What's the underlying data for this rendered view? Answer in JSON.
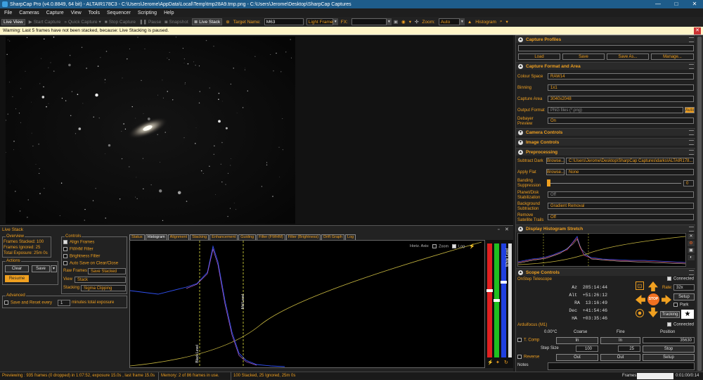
{
  "window": {
    "title": "SharpCap Pro (v4.0.8849, 64 bit) - ALTAIR178C3 - C:\\Users\\Jerome\\AppData\\Local\\Temp\\tmp28A9.tmp.png - C:\\Users\\Jerome\\Desktop\\SharpCap Captures",
    "minimize": "—",
    "maximize": "□",
    "close": "✕"
  },
  "menu": [
    "File",
    "Cameras",
    "Capture",
    "View",
    "Tools",
    "Sequencer",
    "Scripting",
    "Help"
  ],
  "toolbar": {
    "live_view": "Live View",
    "start_capture": "Start Capture",
    "quick_capture": "Quick Capture",
    "stop_capture": "Stop Capture",
    "pause": "Pause",
    "snapshot": "Snapshot",
    "live_stack": "Live Stack",
    "target_label": "Target Name:",
    "target_value": "M63",
    "frame_type": "Light Frames",
    "fx_label": "FX:",
    "zoom_label": "Zoom:",
    "zoom_value": "Auto",
    "histogram": "Histogram"
  },
  "warning": {
    "text": "Warning: Last 5 frames have not been stacked, because: Live Stacking is paused."
  },
  "capture_profiles": {
    "title": "Capture Profiles",
    "load": "Load",
    "save": "Save",
    "save_as": "Save As...",
    "manage": "Manage..."
  },
  "capture_format": {
    "title": "Capture Format and Area",
    "colour_space_label": "Colour Space",
    "colour_space": "RAW14",
    "binning_label": "Binning",
    "binning": "1x1",
    "capture_area_label": "Capture Area",
    "capture_area": "3040x2048",
    "output_format_label": "Output Format",
    "output_format": "PNG files (*.png)",
    "auto": "Auto",
    "debayer_label": "Debayer Preview",
    "debayer": "On"
  },
  "camera_controls": {
    "title": "Camera Controls"
  },
  "image_controls": {
    "title": "Image Controls"
  },
  "preprocessing": {
    "title": "Preprocessing",
    "subtract_dark_label": "Subtract Dark",
    "browse": "Browse...",
    "dark_path": "C:\\Users\\Jerome\\Desktop\\SharpCap Captures\\darks\\ALTAIR178...",
    "apply_flat_label": "Apply Flat",
    "flat_value": "None",
    "banding_label": "Banding Suppression",
    "banding_value": "0",
    "planet_label": "Planet/Disk Stabilization",
    "planet_value": "Off",
    "background_label": "Background Subtraction",
    "background_value": "Gradient Removal",
    "satellite_label": "Remove Satellite Trails",
    "satellite_value": "Off"
  },
  "display_histogram": {
    "title": "Display Histogram Stretch"
  },
  "scope": {
    "title": "Scope Controls",
    "connected": "Connected",
    "telescope": "OnStep Telescope",
    "az_label": "Az",
    "az": "285:14:44",
    "alt_label": "Alt",
    "alt": "+51:26:12",
    "ra_label": "RA",
    "ra": "13:16:49",
    "dec_label": "Dec",
    "dec": "+41:54:46",
    "ha_label": "HA",
    "ha": "+03:35:46",
    "rate_label": "Rate:",
    "rate": "32x",
    "setup": "Setup",
    "park": "Park",
    "tracking": "Tracking",
    "stop": "STOP"
  },
  "focuser": {
    "title": "Arduifocus (M1)",
    "connected": "Connected",
    "temp": "0.00°C",
    "coarse": "Coarse",
    "fine": "Fine",
    "position": "Position",
    "t_comp": "T. Comp",
    "in": "In",
    "position_value": "35630",
    "step_size": "Step Size",
    "coarse_step": "100",
    "fine_step": "25",
    "stop": "Stop",
    "reverse": "Reverse",
    "out": "Out",
    "setup": "Setup"
  },
  "notes": {
    "label": "Notes"
  },
  "live_stack": {
    "title": "Live Stack",
    "overview": "Overview",
    "frames_stacked": "Frames Stacked: 100",
    "frames_ignored": "Frames Ignored:  25",
    "total_exposure": "Total Exposure:  25m 0s",
    "actions": "Actions",
    "clear": "Clear",
    "save": "Save",
    "resume": "Resume",
    "advanced": "Advanced",
    "save_reset": "Save and Reset every",
    "save_reset_value": "1",
    "minutes": "minutes total exposure",
    "controls": "Controls",
    "align": "Align Frames",
    "fwhm": "FWHM Filter",
    "brightness": "Brightness Filter",
    "autosave": "Auto Save on Clear/Close",
    "raw_frames_label": "Raw Frames",
    "raw_frames": "Save Stacked",
    "view_label": "View",
    "view": "Stack",
    "stacking_label": "Stacking",
    "stacking": "Sigma Clipping",
    "tabs": [
      "Status",
      "Histogram",
      "Alignment",
      "Stacking",
      "Enhancement",
      "Guiding",
      "Filter (FWHM)",
      "Filter (Brightness)",
      "Drift Graph",
      "Log"
    ],
    "horiz_axis": "Horiz. Axis:",
    "zoom": "Zoom",
    "log": "Log",
    "black_level": "Black Level",
    "mid_level": "Mid Level",
    "white_level": "White Level"
  },
  "status": {
    "preview": "Previewing : 935 frames (0 dropped) in 1:07:52, exposure 15.0s , last frame 15.0s",
    "memory": "Memory: 2 of 86 frames in use.",
    "stacked": "100 Stacked, 25 Ignored, 25m 0s",
    "frames_label": "Frames:",
    "frames_value": "0:01:00/0:14"
  },
  "colors": {
    "accent": "#f0a020",
    "title_bar": "#1e5c8a",
    "red": "#e02020",
    "green": "#20c020",
    "blue": "#2040e0"
  }
}
